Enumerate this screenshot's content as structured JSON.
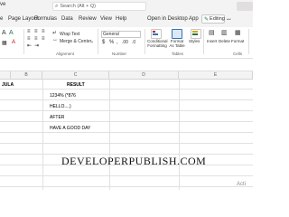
{
  "window": {
    "title_fragment": "ve"
  },
  "search": {
    "text": "Search (Alt + Q)"
  },
  "tabs": [
    {
      "label": "e"
    },
    {
      "label": "Page Layout"
    },
    {
      "label": "Formulas"
    },
    {
      "label": "Data"
    },
    {
      "label": "Review"
    },
    {
      "label": "View"
    },
    {
      "label": "Help"
    },
    {
      "label": "Open in Desktop App"
    }
  ],
  "editing": {
    "label": "Editing"
  },
  "ribbon": {
    "wrap_text": "Wrap Text",
    "merge_center": "Merge & Center",
    "number_format": "General",
    "currency": "$",
    "percent": "%",
    "comma": ",",
    "conditional_formatting": "Conditional Formatting",
    "format_as_table": "Format As Table",
    "styles": "Styles",
    "insert": "Insert",
    "delete": "Delete",
    "format": "Format",
    "group_alignment": "Alignment",
    "group_number": "Number",
    "group_tables": "Tables",
    "group_cells": "Cells"
  },
  "grid": {
    "columns": [
      "B",
      "C",
      "D",
      "E"
    ],
    "header_formula": "JULA",
    "header_result": "RESULT",
    "results": [
      "1234% (*876",
      "HELLO....)",
      "AFTER",
      "HAVE A GOOD DAY"
    ]
  },
  "watermark": "DEVELOPERPUBLISH.COM",
  "activate_text": "Acti",
  "colors": {
    "excel_green": "#217346",
    "ribbon_bg": "#ffffff",
    "tabbar_bg": "#f3f3f3"
  }
}
